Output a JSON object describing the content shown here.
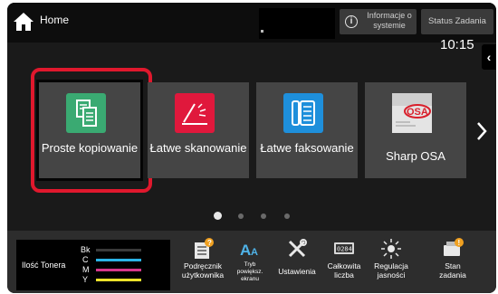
{
  "header": {
    "home_label": "Home",
    "info_label": "Informacje o systemie",
    "status_label": "Status Zadania",
    "time": "10:15"
  },
  "tiles": [
    {
      "label": "Proste kopiowanie",
      "icon": "copy-icon",
      "color": "#3aaa72",
      "highlighted": true
    },
    {
      "label": "Łatwe skanowanie",
      "icon": "scan-icon",
      "color": "#e0183c"
    },
    {
      "label": "Łatwe faksowanie",
      "icon": "fax-icon",
      "color": "#1e8fdb"
    },
    {
      "label": "Sharp OSA",
      "icon": "sharp-osa-icon"
    }
  ],
  "pager": {
    "pages": 4,
    "active": 1
  },
  "toner": {
    "title": "Ilość Tonera",
    "levels": [
      {
        "name": "Bk",
        "color": "#000000"
      },
      {
        "name": "C",
        "color": "#2ab3e6"
      },
      {
        "name": "M",
        "color": "#d6378c"
      },
      {
        "name": "Y",
        "color": "#ece22a"
      }
    ]
  },
  "bottom_items": [
    {
      "label": "Podręcznik użytkownika",
      "icon": "manual-icon"
    },
    {
      "label": "Tryb powiększ. ekranu",
      "icon": "zoom-text-icon"
    },
    {
      "label": "Ustawienia",
      "icon": "settings-icon"
    },
    {
      "label": "Całkowita liczba",
      "icon": "counter-icon"
    },
    {
      "label": "Regulacja jasności",
      "icon": "brightness-icon"
    },
    {
      "label": "Stan zadania",
      "icon": "job-status-icon"
    }
  ],
  "colors": {
    "highlight": "#e0182d",
    "tile_bg": "#454545",
    "screen_bg": "#1a1a1a"
  }
}
